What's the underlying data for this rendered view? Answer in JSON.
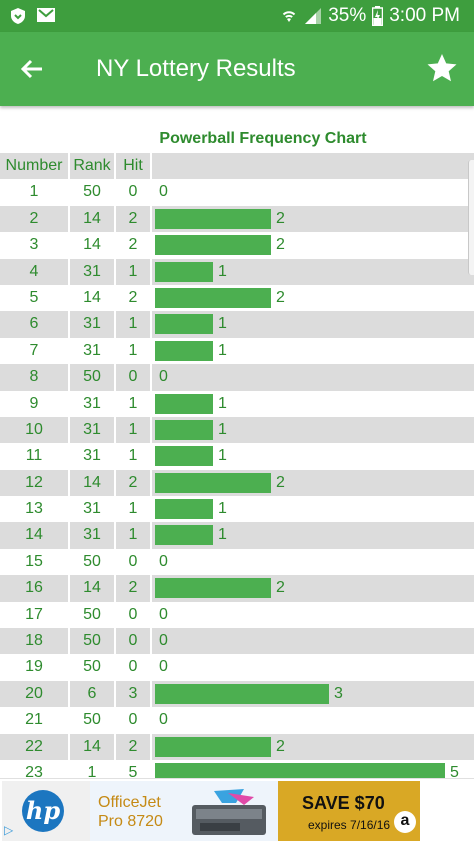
{
  "status_bar": {
    "battery": "35%",
    "time": "3:00 PM"
  },
  "app_bar": {
    "title": "NY Lottery Results"
  },
  "chart": {
    "title": "Powerball Frequency Chart",
    "headers": [
      "Number",
      "Rank",
      "Hit"
    ]
  },
  "chart_data": {
    "type": "bar",
    "title": "Powerball Frequency Chart",
    "categories": [
      "1",
      "2",
      "3",
      "4",
      "5",
      "6",
      "7",
      "8",
      "9",
      "10",
      "11",
      "12",
      "13",
      "14",
      "15",
      "16",
      "17",
      "18",
      "19",
      "20",
      "21",
      "22",
      "23"
    ],
    "ranks": [
      50,
      14,
      14,
      31,
      14,
      31,
      31,
      50,
      31,
      31,
      31,
      14,
      31,
      31,
      50,
      14,
      50,
      50,
      50,
      6,
      50,
      14,
      1
    ],
    "values": [
      0,
      2,
      2,
      1,
      2,
      1,
      1,
      0,
      1,
      1,
      1,
      2,
      1,
      1,
      0,
      2,
      0,
      0,
      0,
      3,
      0,
      2,
      5
    ],
    "xlim": [
      0,
      5
    ]
  },
  "ad": {
    "product": [
      "OfficeJet",
      "Pro 8720"
    ],
    "offer": "SAVE $70",
    "expires": "expires 7/16/16",
    "brand": "hp",
    "amazon": "a"
  }
}
